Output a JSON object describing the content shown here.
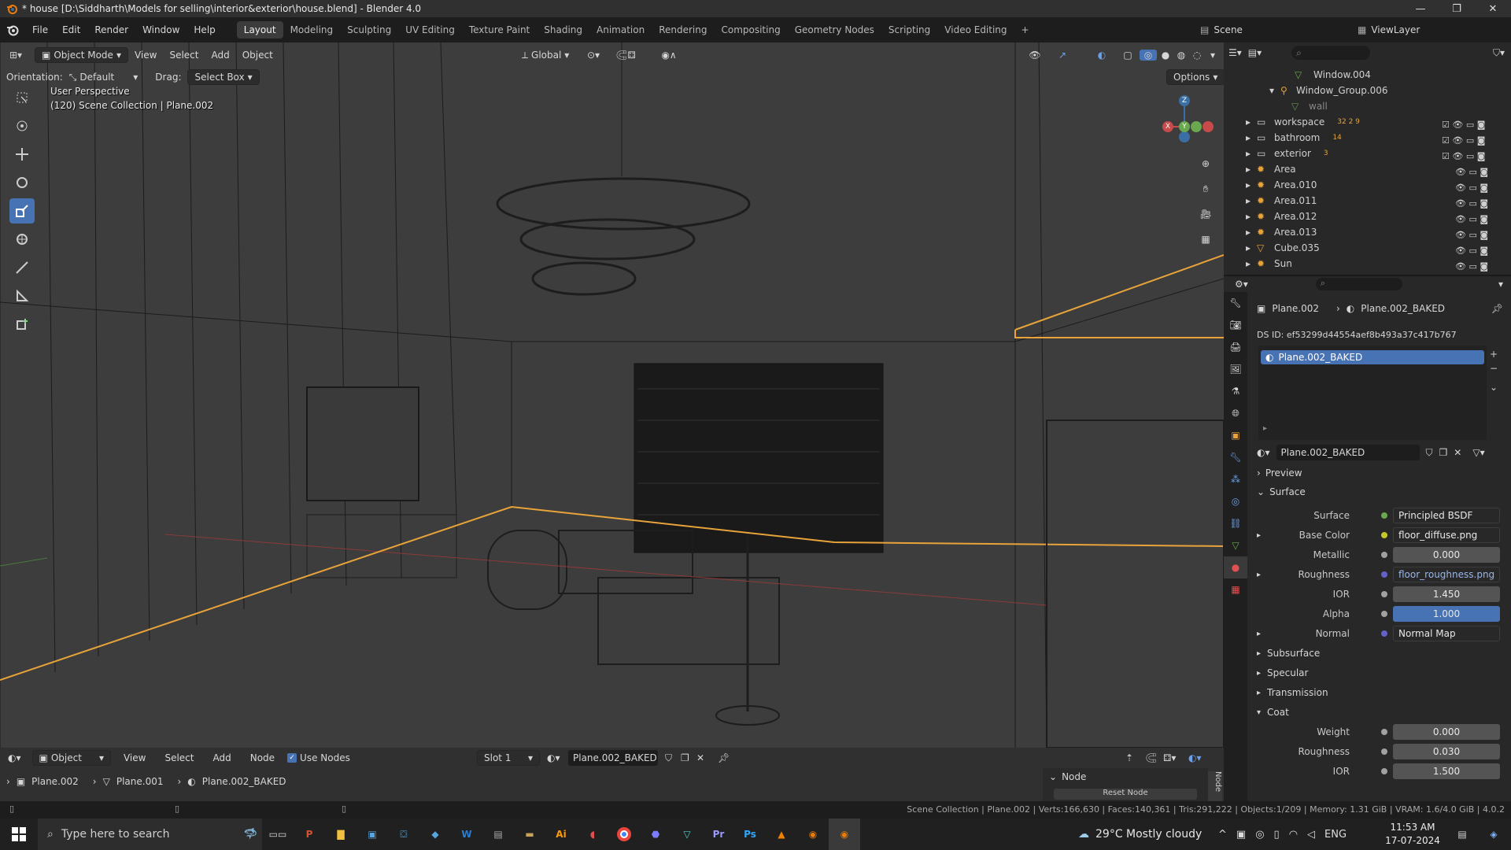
{
  "title": "* house [D:\\Siddharth\\Models for selling\\interior&exterior\\house.blend] - Blender 4.0",
  "menus": [
    "File",
    "Edit",
    "Render",
    "Window",
    "Help"
  ],
  "workspaces": [
    "Layout",
    "Modeling",
    "Sculpting",
    "UV Editing",
    "Texture Paint",
    "Shading",
    "Animation",
    "Rendering",
    "Compositing",
    "Geometry Nodes",
    "Scripting",
    "Video Editing"
  ],
  "scene": "Scene",
  "view_layer": "ViewLayer",
  "viewport": {
    "mode": "Object Mode",
    "menu": [
      "View",
      "Select",
      "Add",
      "Object"
    ],
    "transform": "Global",
    "orientation_label": "Orientation:",
    "orientation_value": "Default",
    "drag_label": "Drag:",
    "drag_value": "Select Box",
    "options": "Options",
    "perspective": "User Perspective",
    "collection_info": "(120) Scene Collection | Plane.002",
    "gizmo": {
      "z": "Z",
      "x": "X",
      "y": "Y"
    }
  },
  "outliner": {
    "rows": [
      {
        "name": "Window.004"
      },
      {
        "name": "Window_Group.006"
      },
      {
        "name": "wall"
      },
      {
        "name": "workspace",
        "badge": "32 2 9"
      },
      {
        "name": "bathroom",
        "badge": "14"
      },
      {
        "name": "exterior",
        "badge": "3"
      },
      {
        "name": "Area"
      },
      {
        "name": "Area.010"
      },
      {
        "name": "Area.011"
      },
      {
        "name": "Area.012"
      },
      {
        "name": "Area.013"
      },
      {
        "name": "Cube.035"
      },
      {
        "name": "Sun"
      }
    ]
  },
  "properties": {
    "breadcrumb_object": "Plane.002",
    "breadcrumb_material": "Plane.002_BAKED",
    "ds_id": "DS ID: ef53299d44554aef8b493a37c417b767",
    "slot_item": "Plane.002_BAKED",
    "material_name": "Plane.002_BAKED",
    "preview": "Preview",
    "surface_section": "Surface",
    "fields": [
      {
        "label": "Surface",
        "value": "Principled BSDF",
        "kind": "node"
      },
      {
        "label": "Base Color",
        "value": "floor_diffuse.png",
        "kind": "node"
      },
      {
        "label": "Metallic",
        "value": "0.000",
        "kind": "num"
      },
      {
        "label": "Roughness",
        "value": "floor_roughness.png",
        "kind": "node"
      },
      {
        "label": "IOR",
        "value": "1.450",
        "kind": "num"
      },
      {
        "label": "Alpha",
        "value": "1.000",
        "kind": "alpha"
      },
      {
        "label": "Normal",
        "value": "Normal Map",
        "kind": "node"
      }
    ],
    "subsections": [
      "Subsurface",
      "Specular",
      "Transmission",
      "Coat"
    ],
    "coat_fields": [
      {
        "label": "Weight",
        "value": "0.000"
      },
      {
        "label": "Roughness",
        "value": "0.030"
      },
      {
        "label": "IOR",
        "value": "1.500"
      }
    ]
  },
  "node_editor": {
    "type": "Object",
    "menu": [
      "View",
      "Select",
      "Add",
      "Node"
    ],
    "use_nodes": "Use Nodes",
    "slot": "Slot 1",
    "material": "Plane.002_BAKED",
    "breadcrumb": [
      "Plane.002",
      "Plane.001",
      "Plane.002_BAKED"
    ],
    "side_panel": "Node",
    "side_tab": "Node",
    "reset": "Reset Node"
  },
  "status": "Scene Collection | Plane.002 | Verts:166,630 | Faces:140,361 | Tris:291,222 | Objects:1/209 | Memory: 1.31 GiB | VRAM: 1.6/4.0 GiB | 4.0.2",
  "taskbar": {
    "search": "Type here to search",
    "weather": "29°C  Mostly cloudy",
    "lang": "ENG",
    "time": "11:53 AM",
    "date": "17-07-2024"
  }
}
